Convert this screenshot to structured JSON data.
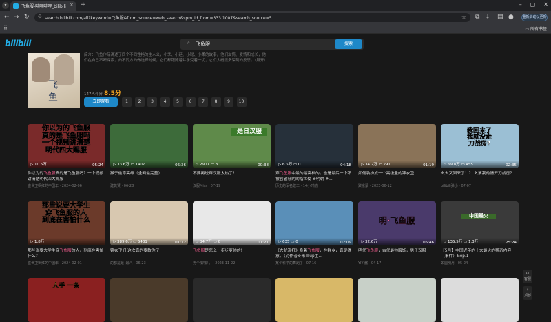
{
  "browser": {
    "tab_title": "飞鱼服-哔哩哔哩_bilibili",
    "tab_close": "×",
    "new_tab": "+",
    "url": "search.bilibili.com/all?keyword=飞鱼服&from_source=web_search&spm_id_from=333.1007&search_source=5",
    "update_button": "重新启动以更新",
    "bookmarks_all": "所有书签",
    "icons": [
      "tab-search-icon",
      "back-icon",
      "forward-icon",
      "reload-icon",
      "lock-icon",
      "star-icon",
      "extensions-icon",
      "download-icon",
      "profile-icon",
      "menu-icon",
      "apps-icon",
      "folder-icon"
    ]
  },
  "header": {
    "logo": "bilibili",
    "search_query": "飞鱼服",
    "search_button": "搜索"
  },
  "hero": {
    "cover_text": [
      "飞",
      "鱼"
    ],
    "intro": "简介：飞鱼作品讲述了四个不同性格的主人公，小季、小廷、小聪、小柔的故事，他们友情、爱情和成长，他们在自己不断探索，向不同方向做选择时候，它们都跟随着并承受着一切，它们大概很多深刻的反思。（展开）",
    "rating_count": "147人评分",
    "rating_score": "8.5分",
    "watch_button": "立即观看",
    "episodes": [
      "1",
      "2",
      "3",
      "4",
      "5",
      "6",
      "7",
      "8",
      "9",
      "10"
    ]
  },
  "row1": [
    {
      "thumb_text": "你以为的飞鱼服\n真的是飞鱼服吗\n一个视频讲清楚\n明代四大赐服",
      "views": "10.6万",
      "danmaku": "",
      "duration": "05:24",
      "title_pre": "你以为的",
      "title_hl": "飞鱼服",
      "title_post": "真的是飞鱼服吗？一个视频讲清楚明代四大赐服",
      "meta": "盛世卫枫红的中国年 · 2024-02-06",
      "bg": "#7a2a2a"
    },
    {
      "thumb_text": "",
      "views": "33.6万",
      "danmaku": "1407",
      "duration": "06:36",
      "title_pre": "",
      "title_hl": "",
      "title_post": "猴子偷穿高级（全网最完整）",
      "meta": "建筑赞 · 06-28",
      "bg": "#3d6b3a"
    },
    {
      "thumb_text": "是日汉服",
      "views": "2907",
      "danmaku": "3",
      "duration": "00:38",
      "title_pre": "",
      "title_hl": "",
      "title_post": "不要再说穿汉服太热了！",
      "meta": "汉服Miss · 07-19",
      "bg": "#5f8a4a"
    },
    {
      "thumb_text": "",
      "views": "6.5万",
      "danmaku": "0",
      "duration": "04:18",
      "title_pre": "穿",
      "title_hl": "飞鱼服",
      "title_post": "中最的最高档的，也是最后一个不被官者穿的的指挥使 #明朝 #...",
      "meta": "历史的军名建工 · 14小时前",
      "bg": "#26303a"
    },
    {
      "thumb_text": "",
      "views": "34.2万",
      "danmaku": "291",
      "duration": "01:19",
      "title_pre": "",
      "title_hl": "",
      "title_post": "如何装扮成一个高级量的锦衣卫",
      "meta": "聚京蒙 · 2023-06-12",
      "bg": "#8a7358"
    },
    {
      "thumb_text": "我回来了\n我就没走\n刀战房?",
      "views": "69.8万",
      "danmaku": "455",
      "duration": "02:35",
      "title_pre": "",
      "title_hl": "",
      "title_post": "幺幺又回来了！？ 幺爹我的情开刀战房？",
      "meta": "bilibili弹小 · 07-07",
      "bg": "#9bbfd4"
    }
  ],
  "row2": [
    {
      "thumb_text": "那些说要大学生\n穿飞鱼服的人\n到底在害怕什么",
      "views": "1.8万",
      "danmaku": "",
      "duration": "",
      "title_pre": "那些说要大学生穿",
      "title_hl": "飞鱼服",
      "title_post": "的人，到底在害怕什么？",
      "meta": "盛世卫枫红的中国年 · 2024-02-01",
      "bg": "#6b3a2a"
    },
    {
      "thumb_text": "",
      "views": "389.6万",
      "danmaku": "5431",
      "duration": "01:12",
      "title_pre": "",
      "title_hl": "",
      "title_post": "锦衣卫们 这次真的要教你了",
      "meta": "的都是最_最八 · 06-23",
      "bg": "#d8c8b0"
    },
    {
      "thumb_text": "",
      "views": "34.7万",
      "danmaku": "6",
      "duration": "01:21",
      "title_pre": "",
      "title_hl": "飞鱼服",
      "title_post": "是怎么一步步变帅的!",
      "meta": "男个嘿嘿儿_ · 2023-11-22",
      "bg": "#e8e8e8"
    },
    {
      "thumb_text": "",
      "views": "635",
      "danmaku": "0",
      "duration": "02:09",
      "title_pre": "《大航海打》身着",
      "title_hl": "飞鱼服",
      "title_post": "，在群乡，真是得意。（对作者专来自up主...",
      "meta": "某个科学的舞蹈子 · 07-16",
      "bg": "#5a8fb8"
    },
    {
      "thumb_text": "明·飞鱼服",
      "views": "32.6万",
      "danmaku": "",
      "duration": "05:46",
      "title_pre": "明代",
      "title_hl": "飞鱼服",
      "title_post": "，古代最帅服饰，男子汉服",
      "meta": "YIYI酱 · 04-17",
      "bg": "#4a3a6b"
    },
    {
      "thumb_text": "中国最火",
      "views": "135.5万",
      "danmaku": "1.3万",
      "duration": "25:24",
      "title_pre": "",
      "title_hl": "",
      "title_post": "【5月】中国近年的十大最火的稀奇内容（事件）&ep.1",
      "meta": "如圆明月 · 05-24",
      "bg": "#3a3a3a"
    }
  ],
  "row3": [
    {
      "thumb_text": "人手 一条",
      "bg": "#8a2020"
    },
    {
      "thumb_text": "",
      "bg": "#4a3a2a"
    },
    {
      "thumb_text": "",
      "bg": "#2a2a2a"
    },
    {
      "thumb_text": "",
      "bg": "#d8b868"
    },
    {
      "thumb_text": "",
      "bg": "#c8d0c8"
    },
    {
      "thumb_text": "",
      "bg": "#dcdcdc"
    }
  ],
  "side": {
    "customer_service": "客服",
    "top": "顶部"
  },
  "colors": {
    "accent": "#1e88c8",
    "highlight": "#f25d8e",
    "rating": "#f5a623"
  }
}
